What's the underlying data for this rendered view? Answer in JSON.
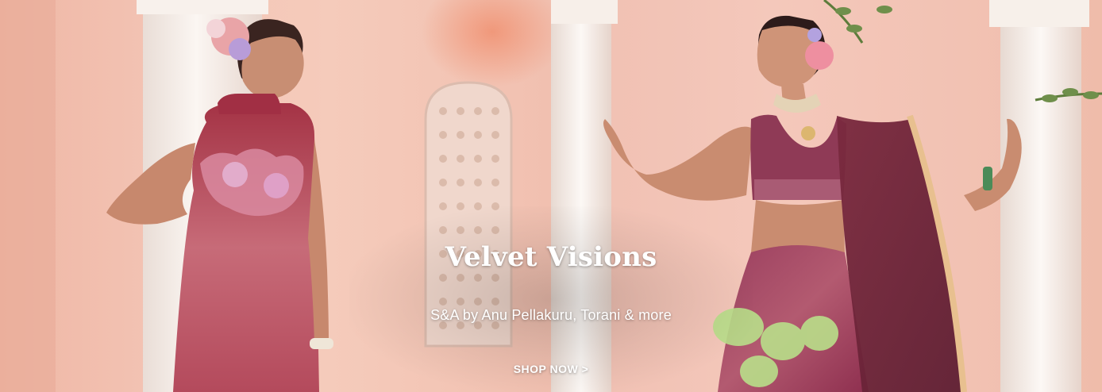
{
  "banner": {
    "title": "Velvet Visions",
    "subtitle": "S&A by Anu Pellakuru, Torani & more",
    "cta_label": "SHOP NOW >"
  },
  "colors": {
    "wall_pink": "#f4c6b7",
    "pillar_white": "#f7f1ec",
    "outfit_red": "#b7465a",
    "outfit_plum": "#7a2f45",
    "text_white": "#ffffff"
  }
}
